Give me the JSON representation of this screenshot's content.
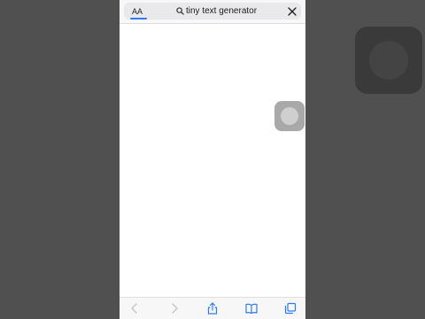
{
  "browser": {
    "reader_button_label": "AA",
    "address_text": "tiny text generator"
  },
  "toolbar": {
    "buttons": [
      "back",
      "forward",
      "share",
      "bookmarks",
      "tabs"
    ]
  },
  "colors": {
    "background": "#505050",
    "page": "#ffffff",
    "accent": "#2d7cf6",
    "toolbar_icon": "#2d7cf6",
    "disabled_icon": "#c4c4c4"
  },
  "icons": [
    "search-icon",
    "close-icon",
    "chevron-left-icon",
    "chevron-right-icon",
    "share-icon",
    "book-icon",
    "tabs-icon"
  ]
}
